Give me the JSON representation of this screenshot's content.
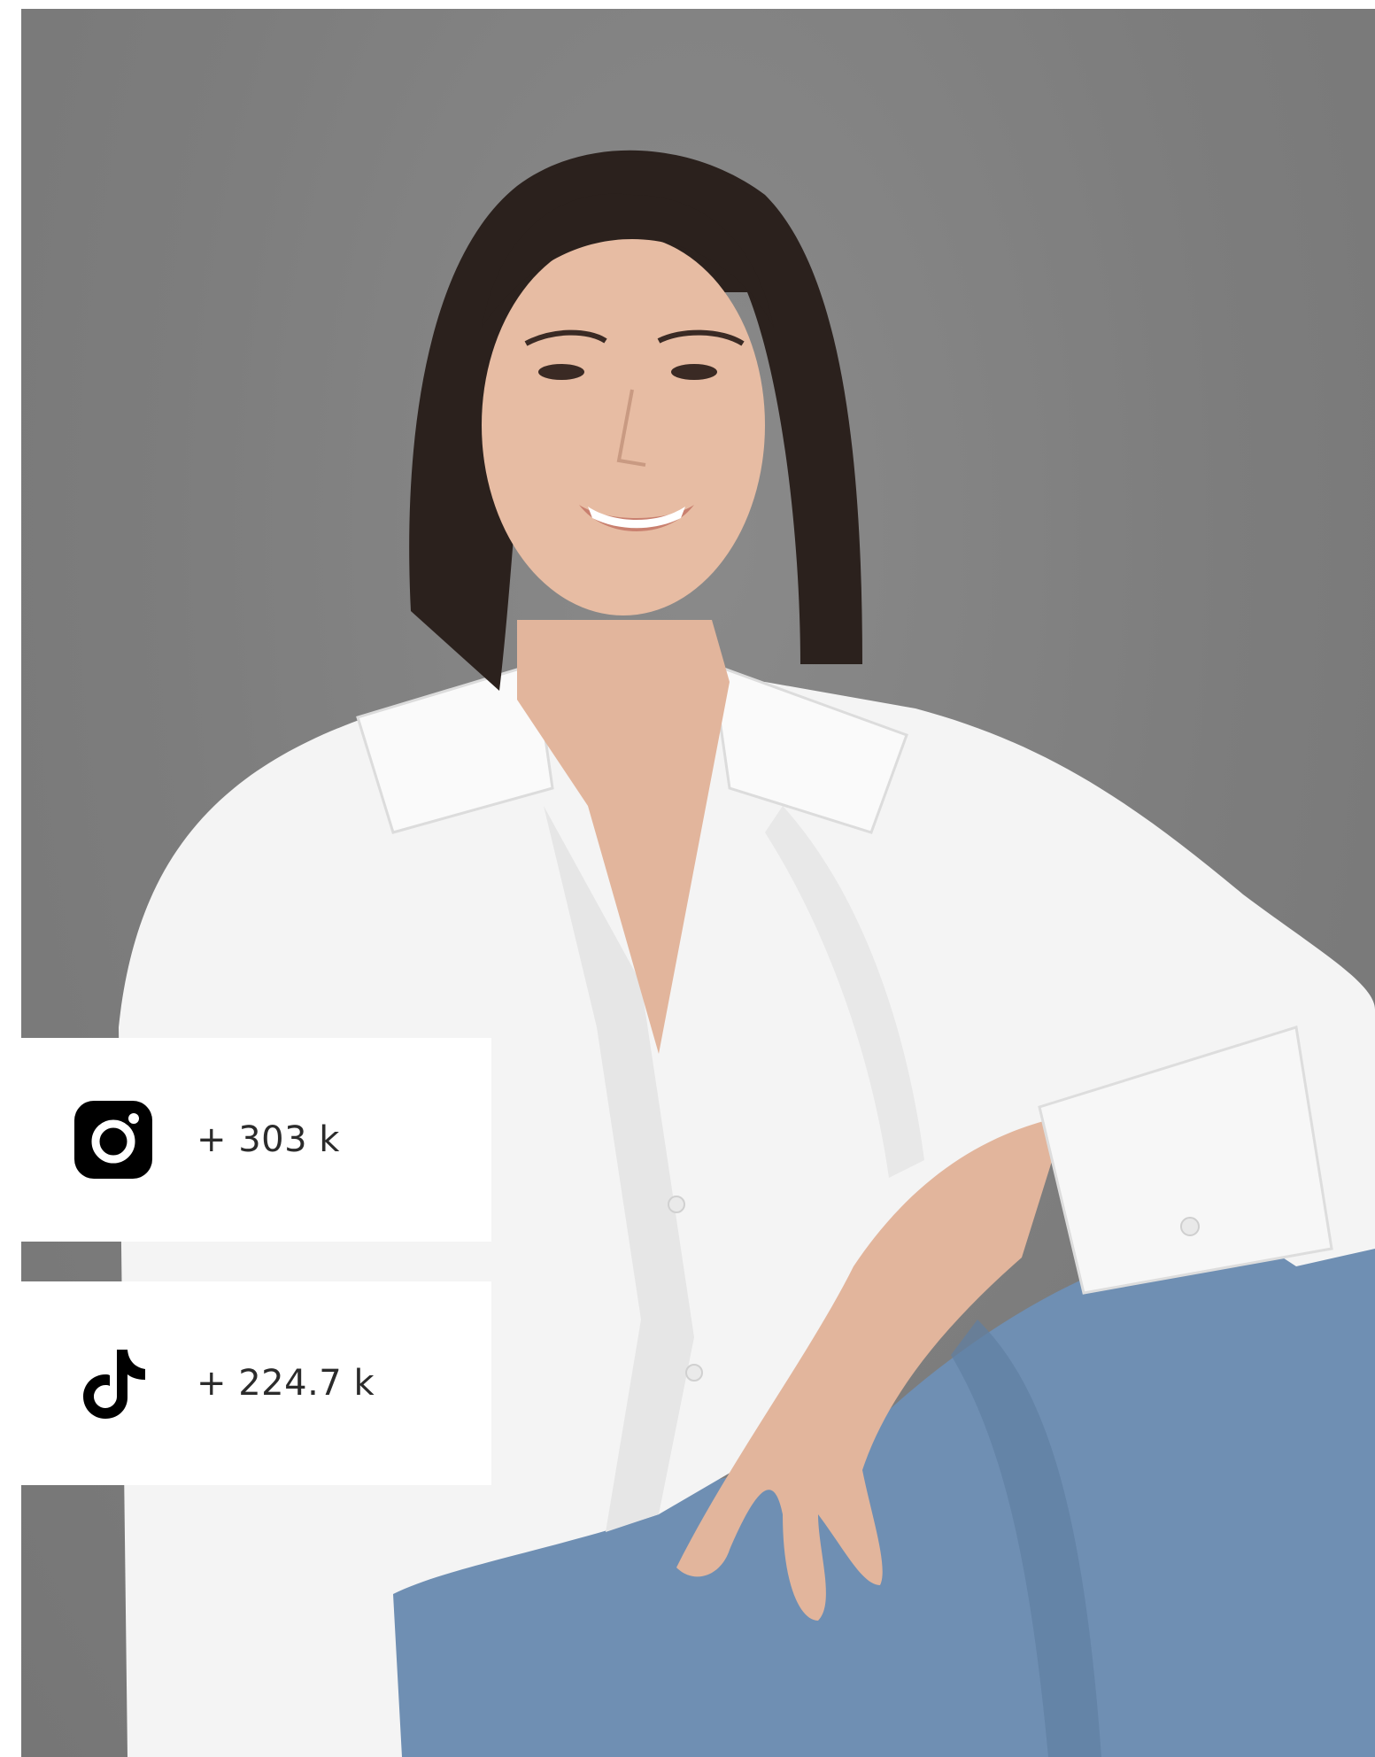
{
  "photo": {
    "subject": "woman",
    "background_color": "#808080"
  },
  "stats": [
    {
      "platform": "instagram",
      "icon": "instagram-icon",
      "value": "+ 303 k"
    },
    {
      "platform": "tiktok",
      "icon": "tiktok-icon",
      "value": "+ 224.7 k"
    }
  ],
  "colors": {
    "card_background": "#ffffff",
    "icon_color": "#000000",
    "text_color": "#2b2b2b",
    "backdrop": "#808080",
    "shirt": "#f4f4f4",
    "jeans": "#6f8fb3",
    "hair": "#2b211d",
    "skin": "#e2b59c"
  }
}
